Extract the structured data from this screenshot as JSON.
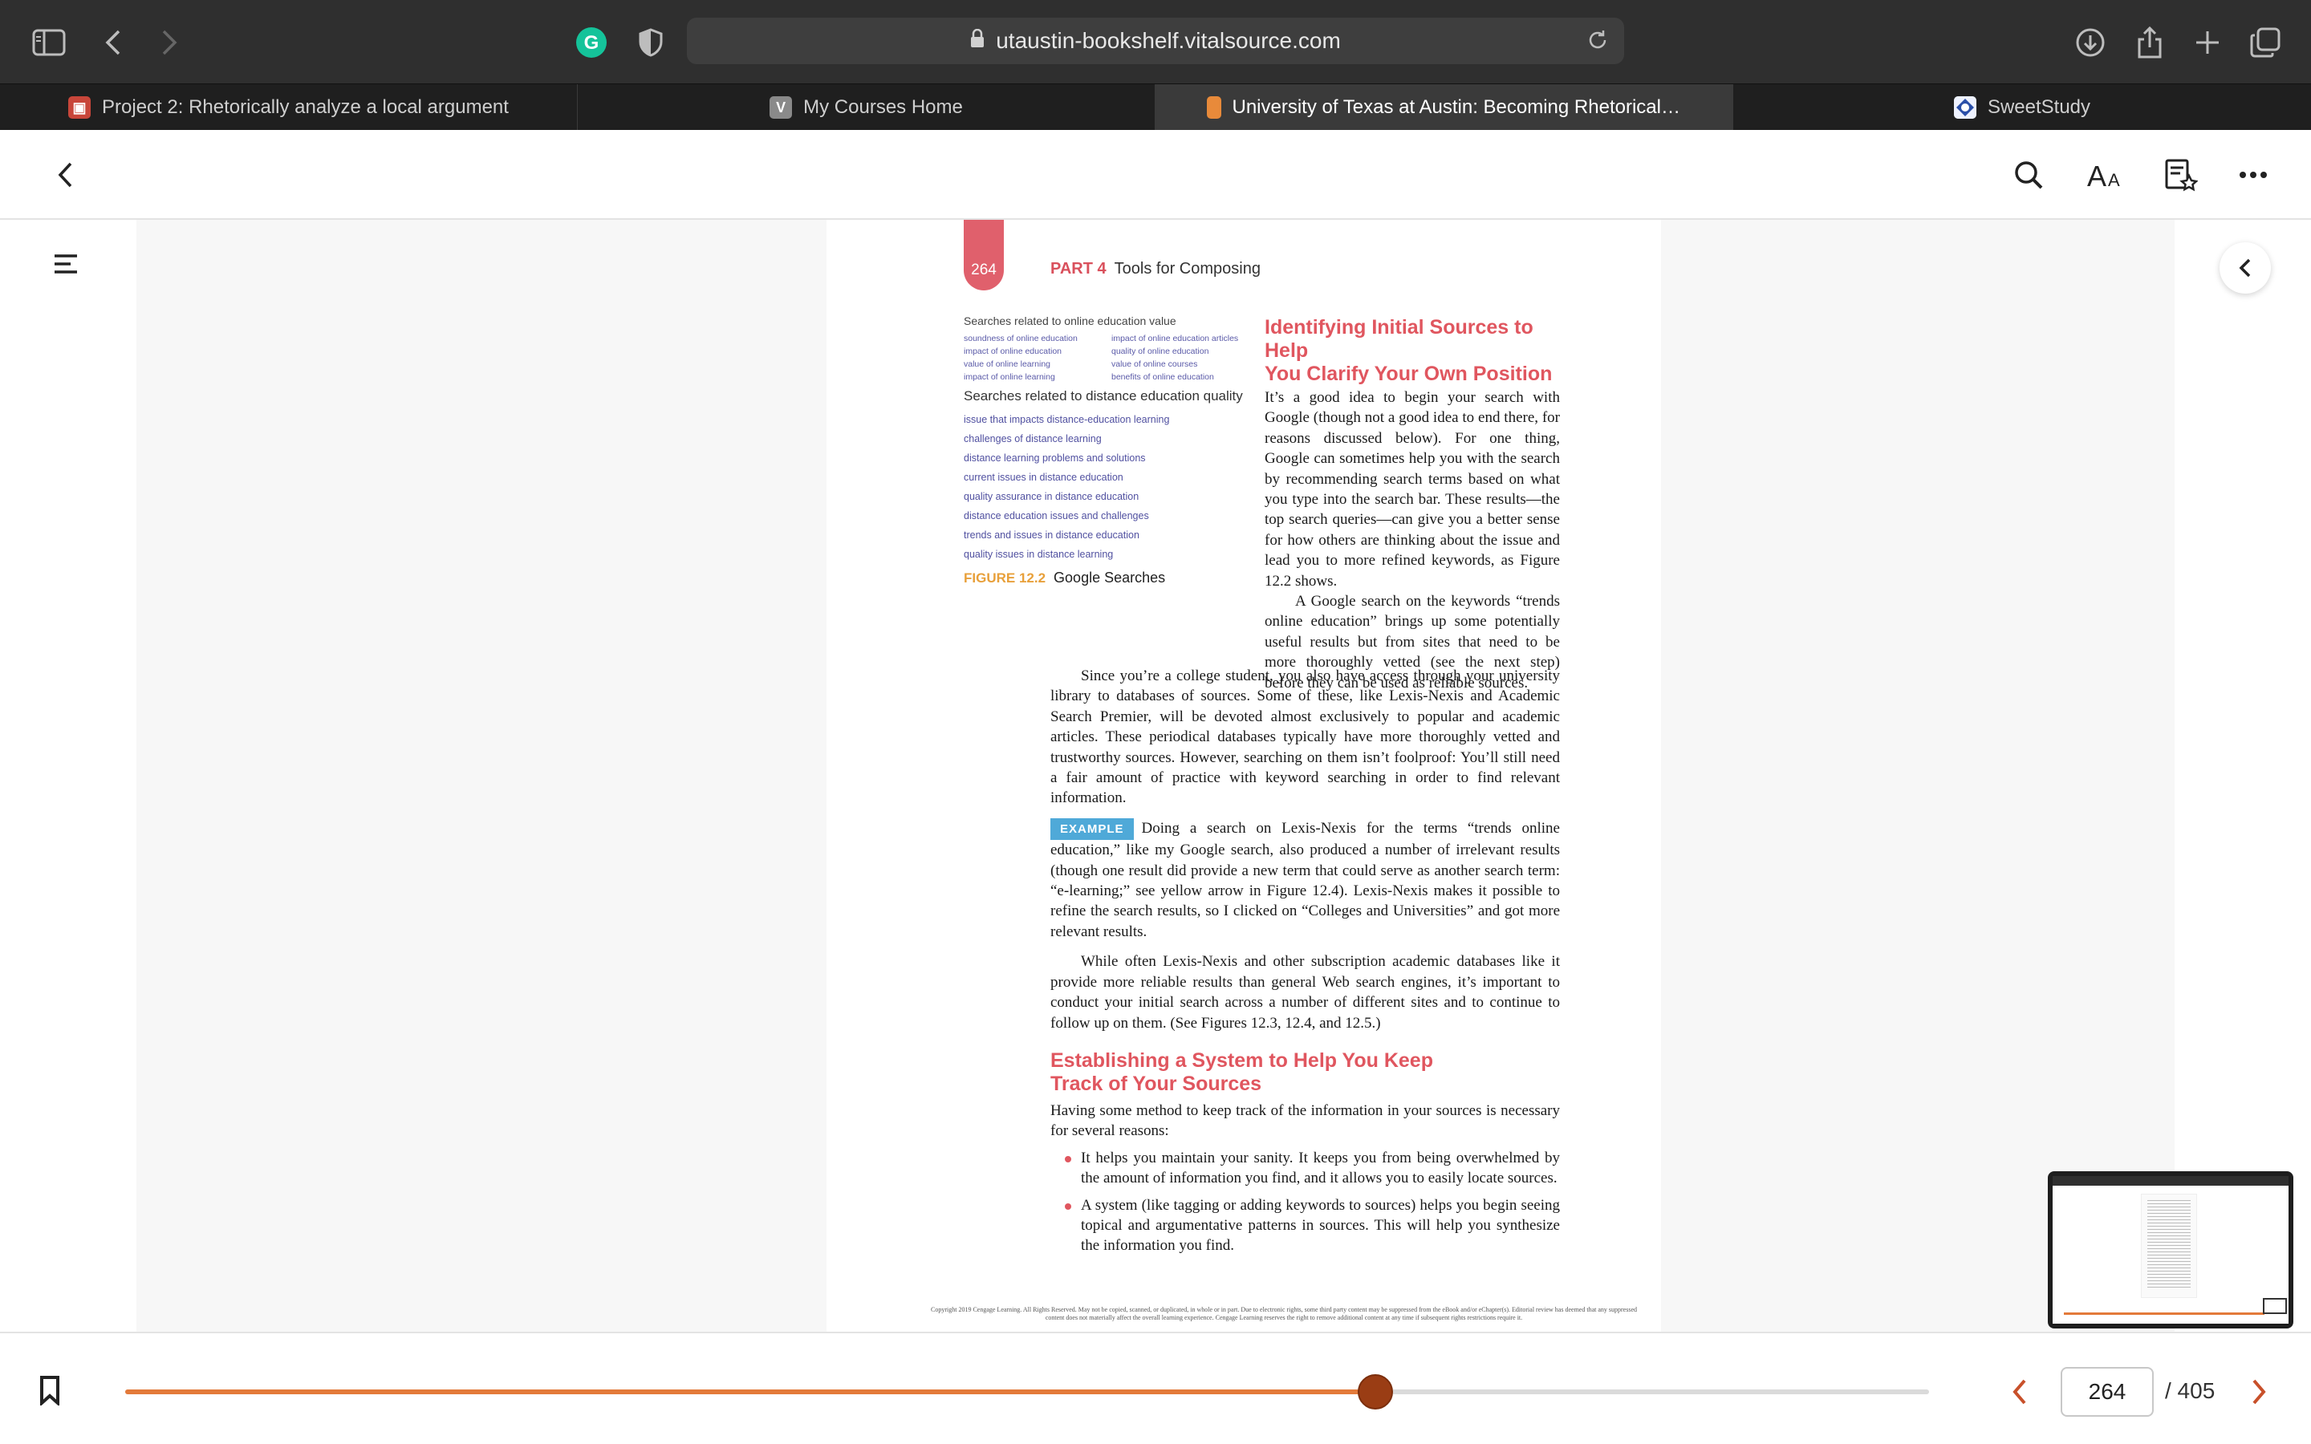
{
  "browser": {
    "url": "utaustin-bookshelf.vitalsource.com",
    "tabs": [
      {
        "label": "Project 2: Rhetorically analyze a local argument",
        "icon": "canvas-favicon",
        "active": false
      },
      {
        "label": "My Courses Home",
        "icon": "v-favicon",
        "active": false
      },
      {
        "label": "University of Texas at Austin: Becoming Rhetorical: Ana...",
        "icon": "vitalsource-favicon",
        "active": true
      },
      {
        "label": "SweetStudy",
        "icon": "sweetstudy-favicon",
        "active": false
      }
    ]
  },
  "page": {
    "number": "264",
    "running_part": "PART 4",
    "running_title": "Tools for Composing",
    "figure": {
      "head1": "Searches related to online education value",
      "grid": [
        "soundness of online education",
        "impact of online education articles",
        "impact of online education",
        "quality of online education",
        "value of online learning",
        "value of online courses",
        "impact of online learning",
        "benefits of online education"
      ],
      "head2": "Searches related to distance education quality",
      "list": [
        "issue that impacts distance-education learning",
        "challenges of distance learning",
        "distance learning problems and solutions",
        "current issues in distance education",
        "quality assurance in distance education",
        "distance education issues and challenges",
        "trends and issues in distance education",
        "quality issues in distance learning"
      ],
      "caption_num": "FIGURE 12.2",
      "caption_text": "Google Searches"
    },
    "heading1_line1": "Identifying Initial Sources to Help",
    "heading1_line2": "You Clarify Your Own Position",
    "p1": "It’s a good idea to begin your search with Google (though not a good idea to end there, for reasons discussed below). For one thing, Google can sometimes help you with the search by recommending search terms based on what you type into the search bar. These results—the top search queries—can give you a better sense for how others are thinking about the issue and lead you to more refined keywords, as Figure 12.2 shows.",
    "p2": "A Google search on the keywords “trends online education” brings up some potentially useful results but from sites that need to be more thoroughly vetted (see the next step) before they can be used as reliable sources.",
    "p3": "Since you’re a college student, you also have access through your university library to databases of sources. Some of these, like Lexis-Nexis and Academic Search Premier, will be devoted almost exclusively to popular and academic articles. These periodical databases typically have more thoroughly vetted and trustworthy sources. However, searching on them isn’t foolproof: You’ll still need a fair amount of practice with keyword searching in order to find relevant information.",
    "example_tag": "EXAMPLE",
    "p4": "Doing a search on Lexis-Nexis for the terms “trends online education,” like my Google search, also produced a number of irrelevant results (though one result did provide a new term that could serve as another search term: “e-learning;” see yellow arrow in Figure 12.4). Lexis-Nexis makes it possible to refine the search results, so I clicked on “Colleges and Universities” and got more relevant results.",
    "p5": "While often Lexis-Nexis and other subscription academic databases like it provide more reliable results than general Web search engines, it’s important to conduct your initial search across a number of different sites and to continue to follow up on them. (See Figures 12.3, 12.4, and 12.5.)",
    "heading2_line1": "Establishing a System to Help You Keep",
    "heading2_line2": "Track of Your Sources",
    "p6": "Having some method to keep track of the information in your sources is necessary for several reasons:",
    "bullets": [
      "It helps you maintain your sanity. It keeps you from being overwhelmed by the amount of information you find, and it allows you to easily locate sources.",
      "A system (like tagging or adding keywords to sources) helps you begin seeing topical and argumentative patterns in sources. This will help you synthesize the information you find."
    ],
    "copyright": "Copyright 2019 Cengage Learning. All Rights Reserved. May not be copied, scanned, or duplicated, in whole or in part. Due to electronic rights, some third party content may be suppressed from the eBook and/or eChapter(s). Editorial review has deemed that any suppressed content does not materially affect the overall learning experience. Cengage Learning reserves the right to remove additional content at any time if subsequent rights restrictions require it."
  },
  "navigation": {
    "current_page": "264",
    "total_pages": "/ 405",
    "progress_fraction": 0.693
  },
  "colors": {
    "accent_orange": "#e37a3a",
    "knob": "#9a3d14",
    "heading_red": "#e0565f"
  }
}
